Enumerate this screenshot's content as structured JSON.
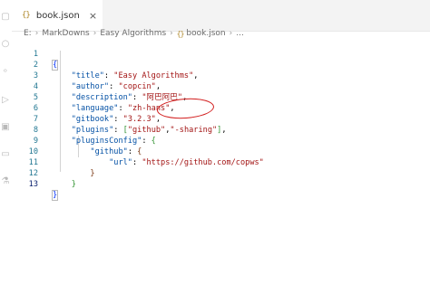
{
  "tab": {
    "icon_text": "{}",
    "label": "book.json",
    "close": "×"
  },
  "breadcrumb": {
    "drive": "E:",
    "folder1": "MarkDowns",
    "folder2": "Easy Algorithms",
    "file_icon": "{}",
    "file": "book.json",
    "more": "..."
  },
  "editor": {
    "lines": [
      {
        "n": "1",
        "text": "{"
      },
      {
        "n": "2",
        "key": "\"title\"",
        "value": "\"Easy Algorithms\""
      },
      {
        "n": "3",
        "key": "\"author\"",
        "value": "\"copcin\""
      },
      {
        "n": "4",
        "key": "\"description\"",
        "value": "\"阿巴阿巴\""
      },
      {
        "n": "5",
        "key": "\"language\"",
        "value": "\"zh-hans\""
      },
      {
        "n": "6",
        "key": "\"gitbook\"",
        "value": "\"3.2.3\""
      },
      {
        "n": "7",
        "key": "\"plugins\"",
        "value1": "\"github\"",
        "value2": "\"-sharing\""
      },
      {
        "n": "8",
        "key": "\"pluginsConfig\""
      },
      {
        "n": "9",
        "key": "\"github\""
      },
      {
        "n": "10",
        "key": "\"url\"",
        "value": "\"https://github.com/copws\""
      },
      {
        "n": "11",
        "text": "}"
      },
      {
        "n": "12",
        "text": "}"
      },
      {
        "n": "13",
        "text": "}"
      }
    ]
  },
  "colors": {
    "annotation": "#d21b1b",
    "key": "#0451a5",
    "string": "#a31515"
  }
}
